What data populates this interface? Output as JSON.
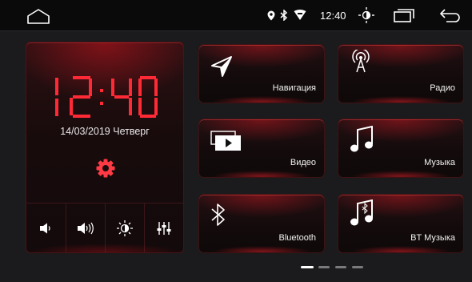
{
  "status_bar": {
    "time": "12:40",
    "icons": [
      "home-icon",
      "location-icon",
      "bluetooth-icon",
      "wifi-icon",
      "brightness-icon",
      "recent-apps-icon",
      "back-icon"
    ]
  },
  "clock_widget": {
    "time": "12:40",
    "date": "14/03/2019 Четверг",
    "buttons": [
      "volume-down-icon",
      "volume-up-icon",
      "brightness-icon",
      "equalizer-icon"
    ]
  },
  "tiles": [
    {
      "label": "Навигация",
      "icon": "navigation-icon"
    },
    {
      "label": "Радио",
      "icon": "radio-antenna-icon"
    },
    {
      "label": "Видео",
      "icon": "video-icon"
    },
    {
      "label": "Музыка",
      "icon": "music-icon"
    },
    {
      "label": "Bluetooth",
      "icon": "bluetooth-icon"
    },
    {
      "label": "BT Музыка",
      "icon": "bt-music-icon"
    }
  ],
  "pager": {
    "pages": 4,
    "active": 0
  },
  "colors": {
    "accent": "#e0202c",
    "background": "#1b1b1d",
    "statusbar": "#0a0a0b"
  }
}
